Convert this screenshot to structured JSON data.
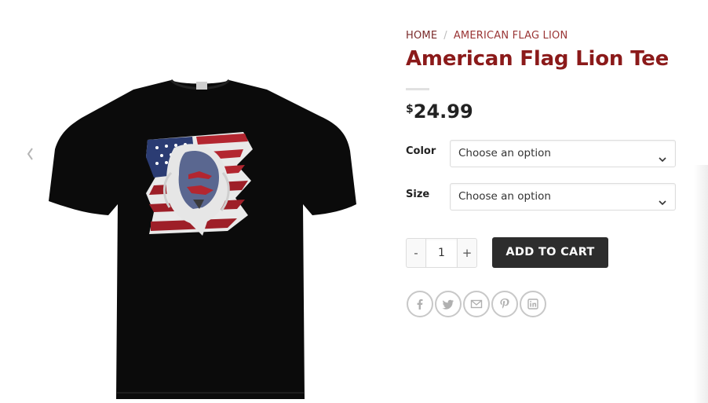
{
  "breadcrumb": {
    "home": "HOME",
    "separator": "/",
    "current": "AMERICAN FLAG LION"
  },
  "product": {
    "title": "American Flag Lion Tee",
    "currency": "$",
    "price": "24.99",
    "image_alt": "Black t-shirt with American flag lion graphic"
  },
  "variations": [
    {
      "label": "Color",
      "value": "Choose an option"
    },
    {
      "label": "Size",
      "value": "Choose an option"
    }
  ],
  "cart": {
    "minus": "-",
    "quantity": "1",
    "plus": "+",
    "add_label": "ADD TO CART"
  },
  "share": [
    "facebook-icon",
    "twitter-icon",
    "email-icon",
    "pinterest-icon",
    "linkedin-icon"
  ],
  "colors": {
    "title": "#8b1a1a",
    "button": "#2d2d2d"
  }
}
